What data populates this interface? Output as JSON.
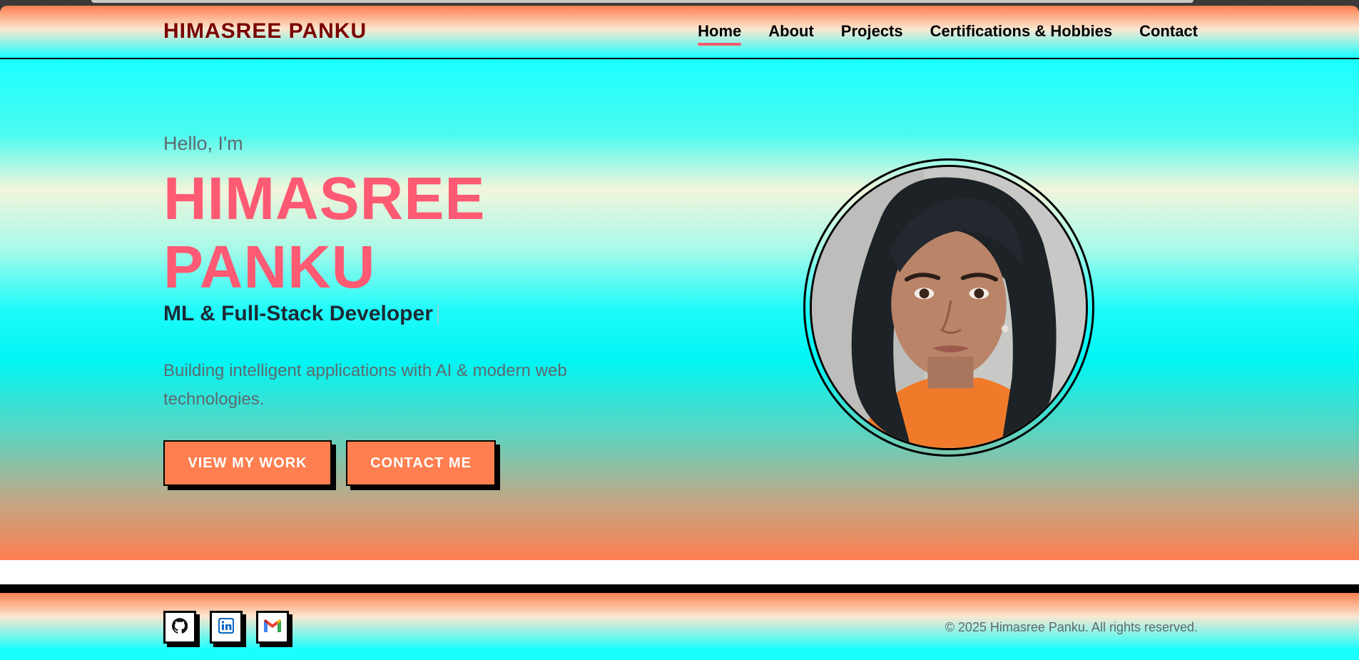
{
  "header": {
    "brand": "HIMASREE PANKU",
    "nav": [
      {
        "label": "Home",
        "active": true
      },
      {
        "label": "About"
      },
      {
        "label": "Projects"
      },
      {
        "label": "Certifications & Hobbies"
      },
      {
        "label": "Contact"
      }
    ]
  },
  "hero": {
    "greeting": "Hello, I'm",
    "name": "HIMASREE PANKU",
    "role": "ML & Full-Stack Developer",
    "tagline": "Building intelligent applications with AI & modern web technologies.",
    "buttons": {
      "view_work": "VIEW MY WORK",
      "contact": "CONTACT ME"
    },
    "photo_alt": "Profile photo"
  },
  "footer": {
    "social": [
      {
        "name": "github-icon"
      },
      {
        "name": "linkedin-icon"
      },
      {
        "name": "gmail-icon"
      }
    ],
    "copyright": "© 2025 Himasree Panku. All rights reserved."
  },
  "colors": {
    "accent": "#ff5a73",
    "button": "#ff7f50",
    "brand": "#7a0000",
    "cyan": "#19ffff"
  }
}
